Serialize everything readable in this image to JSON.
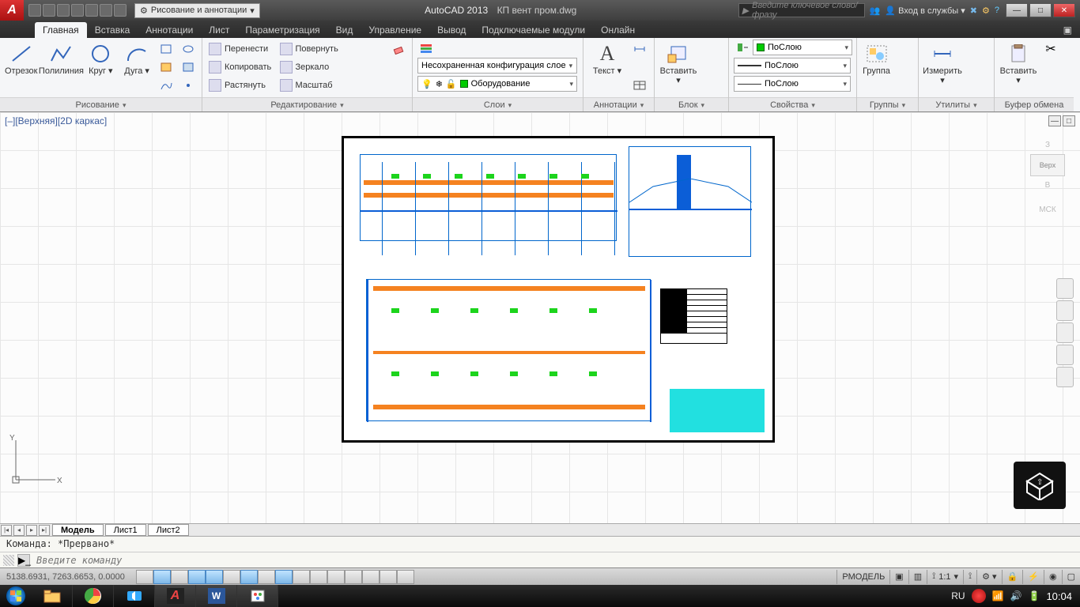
{
  "title": {
    "app": "AutoCAD 2013",
    "file": "КП вент пром.dwg"
  },
  "qat_workspace": "Рисование и аннотации",
  "search_placeholder": "Введите ключевое слово/фразу",
  "signin": "Вход в службы",
  "tabs": [
    "Главная",
    "Вставка",
    "Аннотации",
    "Лист",
    "Параметризация",
    "Вид",
    "Управление",
    "Вывод",
    "Подключаемые модули",
    "Онлайн"
  ],
  "active_tab": 0,
  "ribbon": {
    "draw": {
      "title": "Рисование",
      "items": {
        "line": "Отрезок",
        "polyline": "Полилиния",
        "circle": "Круг",
        "arc": "Дуга"
      }
    },
    "modify": {
      "title": "Редактирование",
      "items": {
        "move": "Перенести",
        "rotate": "Повернуть",
        "copy": "Копировать",
        "mirror": "Зеркало",
        "stretch": "Растянуть",
        "scale": "Масштаб"
      }
    },
    "layers": {
      "title": "Слои",
      "config": "Несохраненная конфигурация слое",
      "current": "Оборудование"
    },
    "annot": {
      "title": "Аннотации",
      "text": "Текст"
    },
    "block": {
      "title": "Блок",
      "insert": "Вставить"
    },
    "props": {
      "title": "Свойства",
      "bylayer": "ПоСлою"
    },
    "groups": {
      "title": "Группы",
      "group": "Группа"
    },
    "utils": {
      "title": "Утилиты",
      "measure": "Измерить"
    },
    "clip": {
      "title": "Буфер обмена",
      "paste": "Вставить"
    }
  },
  "viewport_label": "[–][Верхняя][2D каркас]",
  "viewcube": {
    "top": "Верх",
    "s": "З",
    "n": "В",
    "wcs": "МСК"
  },
  "layout_tabs": [
    "Модель",
    "Лист1",
    "Лист2"
  ],
  "active_layout": 0,
  "command": {
    "history": "Команда: *Прервано*",
    "placeholder": "Введите команду"
  },
  "status": {
    "coords": "5138.6931, 7263.6653, 0.0000",
    "space": "РМОДЕЛЬ",
    "annoscale": "1:1"
  },
  "taskbar": {
    "lang": "RU",
    "clock": "10:04"
  }
}
